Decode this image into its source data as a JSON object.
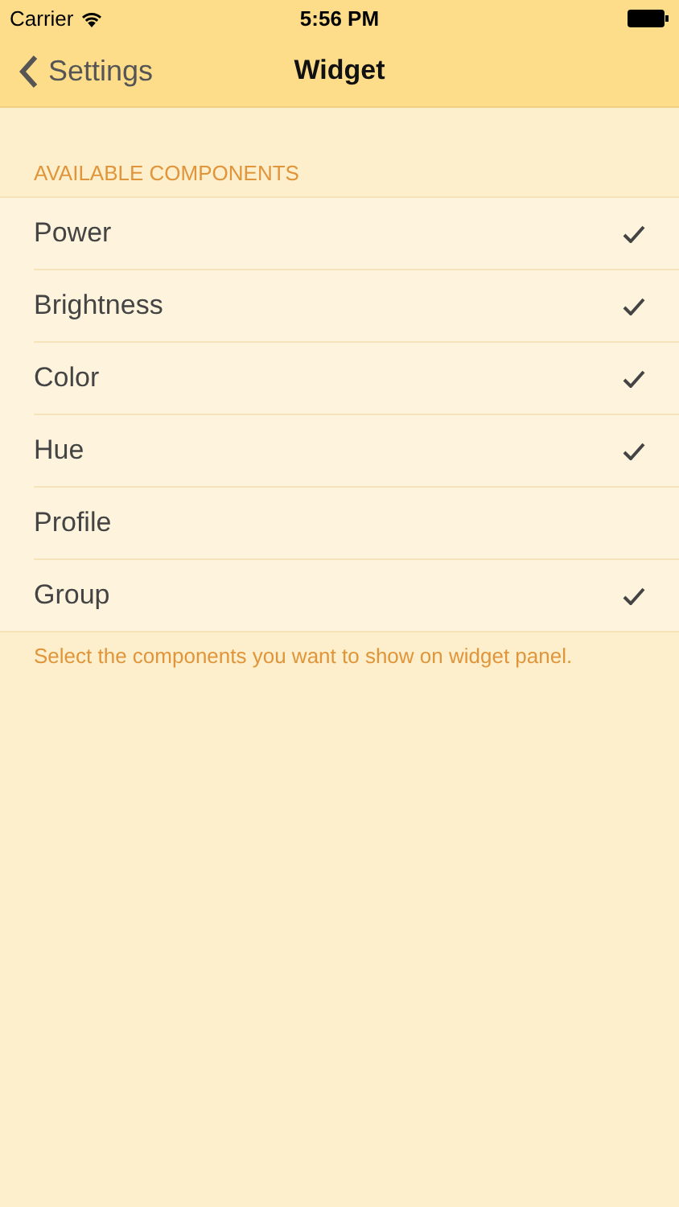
{
  "status_bar": {
    "carrier": "Carrier",
    "time": "5:56 PM"
  },
  "nav_bar": {
    "back": "Settings",
    "title": "Widget"
  },
  "section": {
    "header": "AVAILABLE COMPONENTS",
    "footer": "Select the components you want to show on widget panel.",
    "items": [
      {
        "label": "Power",
        "checked": true
      },
      {
        "label": "Brightness",
        "checked": true
      },
      {
        "label": "Color",
        "checked": true
      },
      {
        "label": "Hue",
        "checked": true
      },
      {
        "label": "Profile",
        "checked": false
      },
      {
        "label": "Group",
        "checked": true
      }
    ]
  }
}
